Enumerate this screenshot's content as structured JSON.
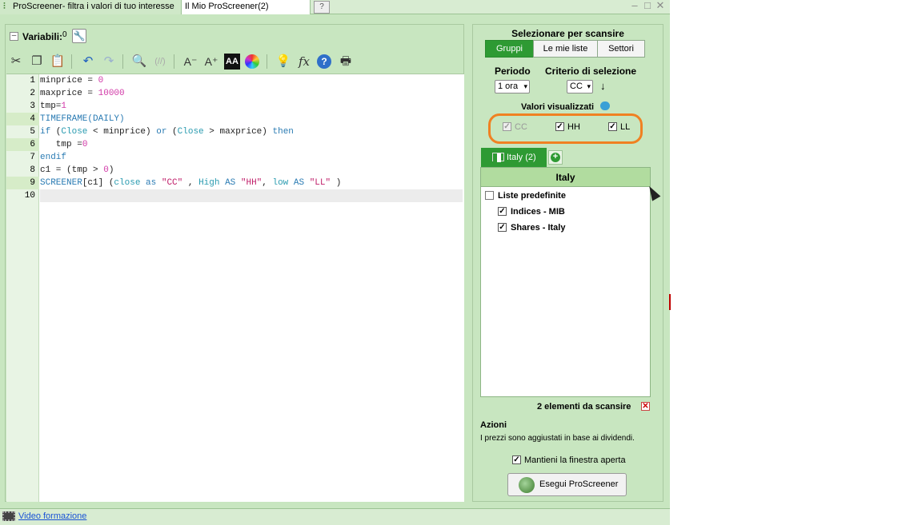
{
  "tabs": {
    "app_title": "ProScreener- filtra i valori di tuo interesse",
    "my_screener": "Il Mio ProScreener(2)"
  },
  "left": {
    "variables_label": "Variabili:",
    "variables_count": "0"
  },
  "code_lines": [
    "1",
    "2",
    "3",
    "4",
    "5",
    "6",
    "7",
    "8",
    "9",
    "10"
  ],
  "code": {
    "l1a": "minprice = ",
    "l1b": "0",
    "l2a": "maxprice = ",
    "l2b": "10000",
    "l3a": "tmp=",
    "l3b": "1",
    "l4": "TIMEFRAME(DAILY)",
    "l5a": "if",
    "l5b": " (",
    "l5c": "Close",
    "l5d": " < minprice) ",
    "l5e": "or",
    "l5f": " (",
    "l5g": "Close",
    "l5h": " > maxprice) ",
    "l5i": "then",
    "l6a": "   tmp =",
    "l6b": "0",
    "l7": "endif",
    "l8a": "c1 = (tmp > ",
    "l8b": "0",
    "l8c": ")",
    "l9a": "SCREENER",
    "l9b": "[c1] (",
    "l9c": "close",
    "l9d": " as ",
    "l9e": "\"CC\"",
    "l9f": " , ",
    "l9g": "High",
    "l9h": " AS ",
    "l9i": "\"HH\"",
    "l9j": ", ",
    "l9k": "low",
    "l9l": " AS ",
    "l9m": "\"LL\"",
    "l9n": " )"
  },
  "right": {
    "select_title": "Selezionare per scansire",
    "seg_groups": "Gruppi",
    "seg_lists": "Le mie liste",
    "seg_sectors": "Settori",
    "period_label": "Periodo",
    "criteria_label": "Criterio di selezione",
    "period_value": "1 ora",
    "criteria_value": "CC",
    "values_label": "Valori visualizzati",
    "val_cc": "CC",
    "val_hh": "HH",
    "val_ll": "LL",
    "country_tab": "Italy (2)",
    "list_header": "Italy",
    "list_predef": "Liste predefinite",
    "list_indices": "Indices - MIB",
    "list_shares": "Shares - Italy",
    "count_text": "2 elementi da scansire",
    "actions_title": "Azioni",
    "dividends_note": "I prezzi sono aggiustati in base ai dividendi.",
    "keep_open": "Mantieni la finestra aperta",
    "run_button": "Esegui ProScreener"
  },
  "status": {
    "video_link": "Video formazione"
  },
  "colors": {
    "accent_green": "#2e9a33",
    "panel_green": "#c8e6c0",
    "highlight_orange": "#f08122"
  },
  "icons": [
    "cut-icon",
    "copy-icon",
    "paste-icon",
    "undo-icon",
    "redo-icon",
    "search-icon",
    "comment-icon",
    "decrease-font-icon",
    "increase-font-icon",
    "font-style-icon",
    "color-wheel-icon",
    "lightbulb-icon",
    "function-icon",
    "help-icon",
    "print-icon"
  ]
}
